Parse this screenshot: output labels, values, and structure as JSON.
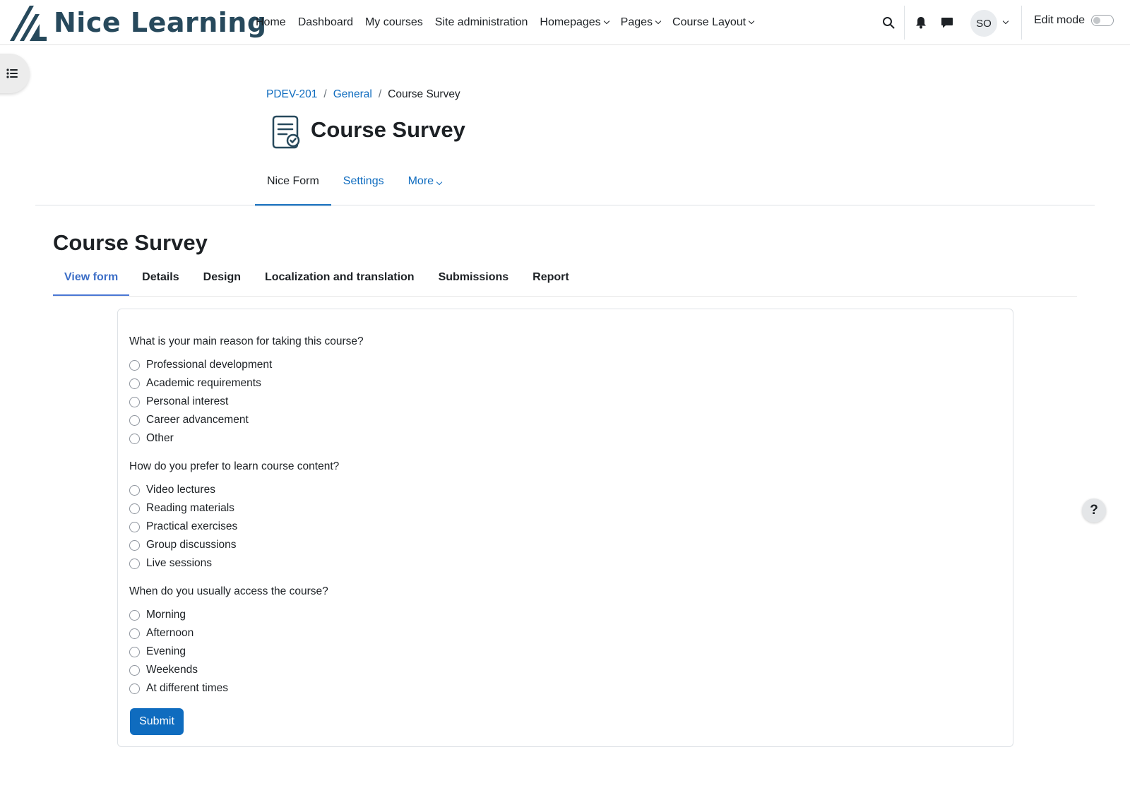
{
  "brand": {
    "name": "Nice Learning",
    "color": "#27495c"
  },
  "navbar": {
    "items": [
      {
        "label": "Home",
        "dropdown": false
      },
      {
        "label": "Dashboard",
        "dropdown": false
      },
      {
        "label": "My courses",
        "dropdown": false
      },
      {
        "label": "Site administration",
        "dropdown": false
      },
      {
        "label": "Homepages",
        "dropdown": true
      },
      {
        "label": "Pages",
        "dropdown": true
      },
      {
        "label": "Course Layout",
        "dropdown": true
      }
    ],
    "user_initials": "SO",
    "edit_mode_label": "Edit mode",
    "edit_mode_on": false,
    "icons": [
      "search-icon",
      "bell-icon",
      "chat-icon",
      "chevron-down-icon"
    ]
  },
  "breadcrumb": {
    "items": [
      "PDEV-201",
      "General"
    ],
    "separator": "/",
    "current": "Course Survey"
  },
  "page": {
    "title": "Course Survey",
    "icon": "form-document-icon"
  },
  "secondary_nav": {
    "tabs": [
      {
        "label": "Nice Form",
        "active": true
      },
      {
        "label": "Settings",
        "active": false
      },
      {
        "label": "More",
        "active": false,
        "dropdown": true
      }
    ]
  },
  "form": {
    "title": "Course Survey",
    "tabs": [
      {
        "label": "View form",
        "active": true
      },
      {
        "label": "Details",
        "active": false
      },
      {
        "label": "Design",
        "active": false
      },
      {
        "label": "Localization and translation",
        "active": false
      },
      {
        "label": "Submissions",
        "active": false
      },
      {
        "label": "Report",
        "active": false
      }
    ],
    "questions": [
      {
        "text": "What is your main reason for taking this course?",
        "options": [
          "Professional development",
          "Academic requirements",
          "Personal interest",
          "Career advancement",
          "Other"
        ]
      },
      {
        "text": "How do you prefer to learn course content?",
        "options": [
          "Video lectures",
          "Reading materials",
          "Practical exercises",
          "Group discussions",
          "Live sessions"
        ]
      },
      {
        "text": "When do you usually access the course?",
        "options": [
          "Morning",
          "Afternoon",
          "Evening",
          "Weekends",
          "At different times"
        ]
      }
    ],
    "submit_label": "Submit"
  },
  "help": {
    "label": "?"
  },
  "colors": {
    "link": "#0f6cbf",
    "primary_button": "#0f6cbf",
    "active_form_tab": "#3d6fc7"
  }
}
